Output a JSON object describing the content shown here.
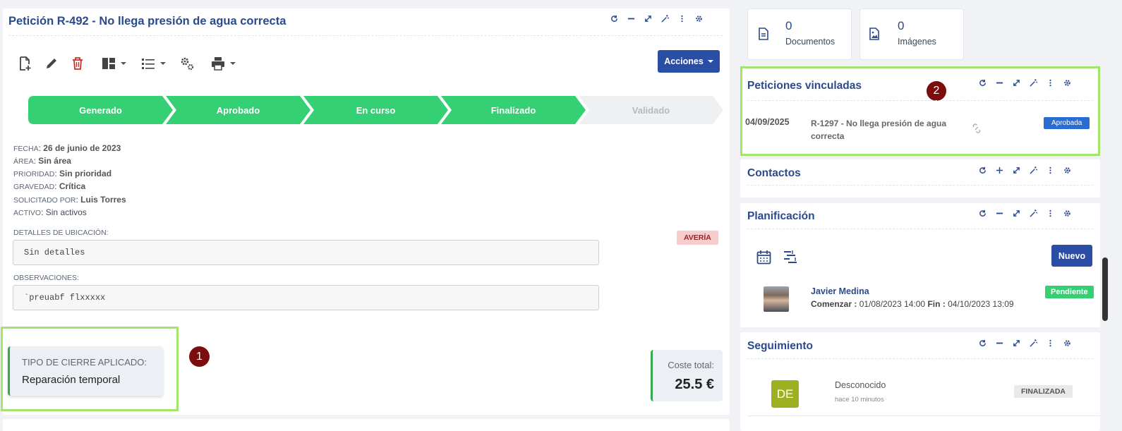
{
  "main": {
    "title": "Petición R-492 - No llega presión de agua correcta",
    "actions_label": "Acciones",
    "steps": [
      {
        "label": "Generado",
        "done": true
      },
      {
        "label": "Aprobado",
        "done": true
      },
      {
        "label": "En curso",
        "done": true
      },
      {
        "label": "Finalizado",
        "done": true
      },
      {
        "label": "Validado",
        "done": false
      }
    ],
    "fields": [
      {
        "key": "FECHA",
        "value": "26 de junio de 2023",
        "bold": true
      },
      {
        "key": "ÁREA",
        "value": "Sin área",
        "bold": true
      },
      {
        "key": "PRIORIDAD",
        "value": "Sin prioridad",
        "bold": true
      },
      {
        "key": "GRAVEDAD",
        "value": "Crítica",
        "bold": true
      },
      {
        "key": "SOLICITADO POR",
        "value": "Luis Torres",
        "bold": true
      },
      {
        "key": "ACTIVO",
        "value": "Sin activos",
        "bold": false
      }
    ],
    "location_label": "DETALLES DE UBICACIÓN:",
    "location_value": "Sin detalles",
    "obs_label": "OBSERVACIONES:",
    "obs_value": "`preuabf flxxxxx",
    "type_badge": "AVERÍA",
    "closure_label": "TIPO DE CIERRE APLICADO:",
    "closure_value": "Reparación temporal",
    "cost_label": "Coste total:",
    "cost_value": "25.5 €",
    "marker1": "1"
  },
  "stats": [
    {
      "count": "0",
      "label": "Documentos",
      "icon": "document-icon"
    },
    {
      "count": "0",
      "label": "Imágenes",
      "icon": "image-icon"
    }
  ],
  "linked": {
    "title": "Peticiones vinculadas",
    "marker2": "2",
    "date": "04/09/2025",
    "text_line1": "R-1297 - No llega presión de agua",
    "text_line2": "correcta",
    "status": "Aprobada"
  },
  "contacts": {
    "title": "Contactos"
  },
  "planning": {
    "title": "Planificación",
    "new_label": "Nuevo",
    "person": "Javier Medina",
    "start_label": "Comenzar :",
    "start_value": "01/08/2023 14:00",
    "end_label": "Fin :",
    "end_value": "04/10/2023 13:09",
    "status": "Pendiente"
  },
  "tracking": {
    "title": "Seguimiento",
    "avatar": "DE",
    "name": "Desconocido",
    "time": "hace 10 minutos",
    "status": "FINALIZADA"
  },
  "colors": {
    "brand": "#2a4a8c",
    "step_done": "#34d073",
    "step_todo": "#eef0f2",
    "highlight": "#a3e56a",
    "marker": "#7d0d0d",
    "danger": "#c9302c"
  }
}
